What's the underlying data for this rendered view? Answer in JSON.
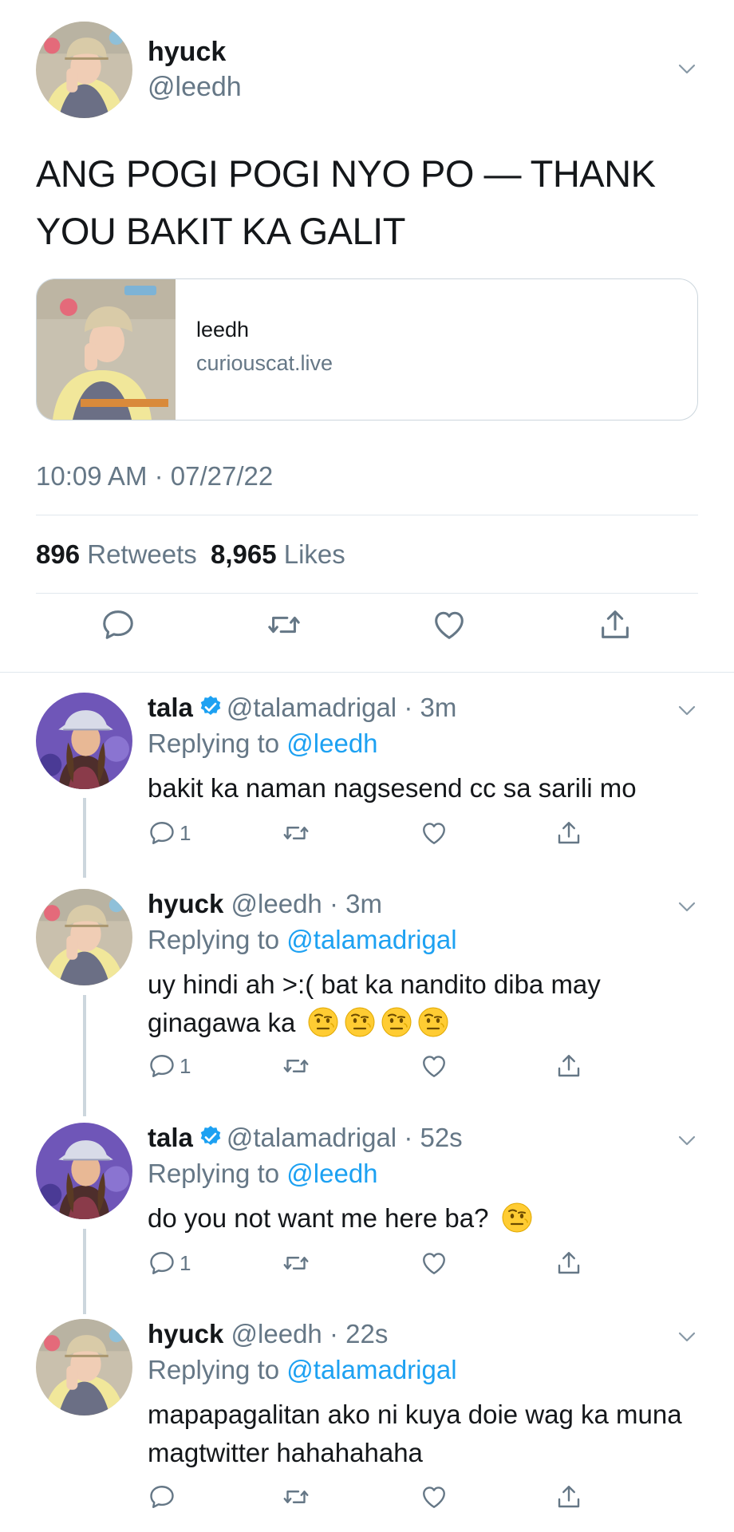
{
  "main_tweet": {
    "name": "hyuck",
    "handle": "@leedh",
    "text": "ANG POGI POGI NYO PO — THANK YOU BAKIT KA GALIT",
    "card": {
      "title": "leedh",
      "domain": "curiouscat.live"
    },
    "timestamp": "10:09 AM · 07/27/22",
    "retweets_count": "896",
    "retweets_label": "Retweets",
    "likes_count": "8,965",
    "likes_label": "Likes"
  },
  "replies": [
    {
      "name": "tala",
      "verified": true,
      "handle": "@talamadrigal",
      "time": "· 3m",
      "replying_prefix": "Replying to",
      "replying_to": "@leedh",
      "text": "bakit ka naman nagsesend cc sa sarili mo",
      "reply_count": "1"
    },
    {
      "name": "hyuck",
      "verified": false,
      "handle": "@leedh",
      "time": "· 3m",
      "replying_prefix": "Replying to",
      "replying_to": "@talamadrigal",
      "text": "uy hindi ah >:( bat ka nandito diba may ginagawa ka",
      "emoji_count": 4,
      "reply_count": "1"
    },
    {
      "name": "tala",
      "verified": true,
      "handle": "@talamadrigal",
      "time": "· 52s",
      "replying_prefix": "Replying to",
      "replying_to": "@leedh",
      "text": "do you not want me here ba?",
      "emoji_count": 1,
      "reply_count": "1"
    },
    {
      "name": "hyuck",
      "verified": false,
      "handle": "@leedh",
      "time": "· 22s",
      "replying_prefix": "Replying to",
      "replying_to": "@talamadrigal",
      "text": "mapapagalitan ako ni kuya doie wag ka muna magtwitter hahahahaha",
      "reply_count": ""
    }
  ],
  "icons": [
    "reply-icon",
    "retweet-icon",
    "like-icon",
    "share-icon",
    "chevron-down-icon",
    "verified-badge-icon",
    "raised-eyebrow-emoji"
  ],
  "colors": {
    "accent": "#1da1f2",
    "muted": "#657786",
    "text": "#14171a",
    "border": "#e1e8ed"
  }
}
